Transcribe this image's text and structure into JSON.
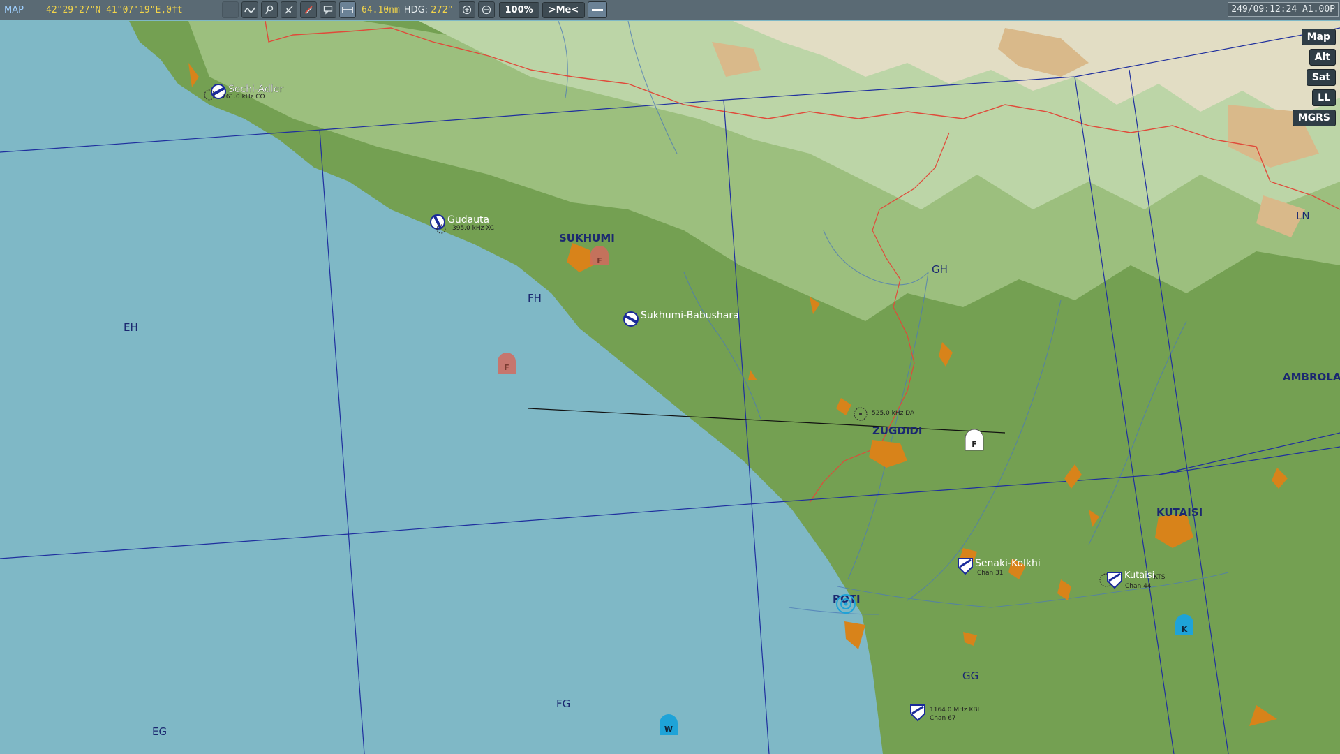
{
  "toolbar": {
    "mode_label": "MAP",
    "coordinates": "42°29'27\"N 41°07'19\"E,0ft",
    "range": "64.10nm",
    "hdg_label": "HDG:",
    "hdg_value": "272°",
    "zoom_label": "100%",
    "me_label": ">Me<",
    "time": "249/09:12:24 A1.00P"
  },
  "layers": {
    "map": "Map",
    "alt": "Alt",
    "sat": "Sat",
    "ll": "LL",
    "mgrs": "MGRS"
  },
  "grid_labels": {
    "eh": "EH",
    "fh": "FH",
    "fg": "FG",
    "eg": "EG",
    "gh": "GH",
    "gg": "GG",
    "ln": "LN"
  },
  "cities": {
    "sukhumi": "SUKHUMI",
    "zugdidi": "ZUGDIDI",
    "kutaisi": "KUTAISI",
    "ambrola": "AMBROLA",
    "poti": "POTI"
  },
  "airfields": {
    "sochi": {
      "name": "Sochi-Adler",
      "freq": "761.0 kHz CO"
    },
    "gudauta": {
      "name": "Gudauta",
      "freq": "395.0 kHz XC"
    },
    "babushara": {
      "name": "Sukhumi-Babushara"
    },
    "senaki": {
      "name": "Senaki-Kolkhi",
      "freq": "Chan 31"
    },
    "kutaisi": {
      "name": "Kutaisi",
      "freq": "KTS",
      "chan": "Chan 44"
    },
    "kobuleti": {
      "freq": "1164.0 MHz KBL",
      "chan": "Chan 67"
    }
  },
  "ndb": {
    "zugdidi": "525.0 kHz DA"
  },
  "markers": {
    "f1": "F",
    "f2": "F",
    "f3": "F",
    "k": "K",
    "w": "W"
  },
  "colors": {
    "sea": "#7fb8c6",
    "land": "#74a052",
    "grid": "#1f2f9e",
    "border": "#e04a3a",
    "town": "#d8831a",
    "toolbar": "#5a6a74"
  }
}
